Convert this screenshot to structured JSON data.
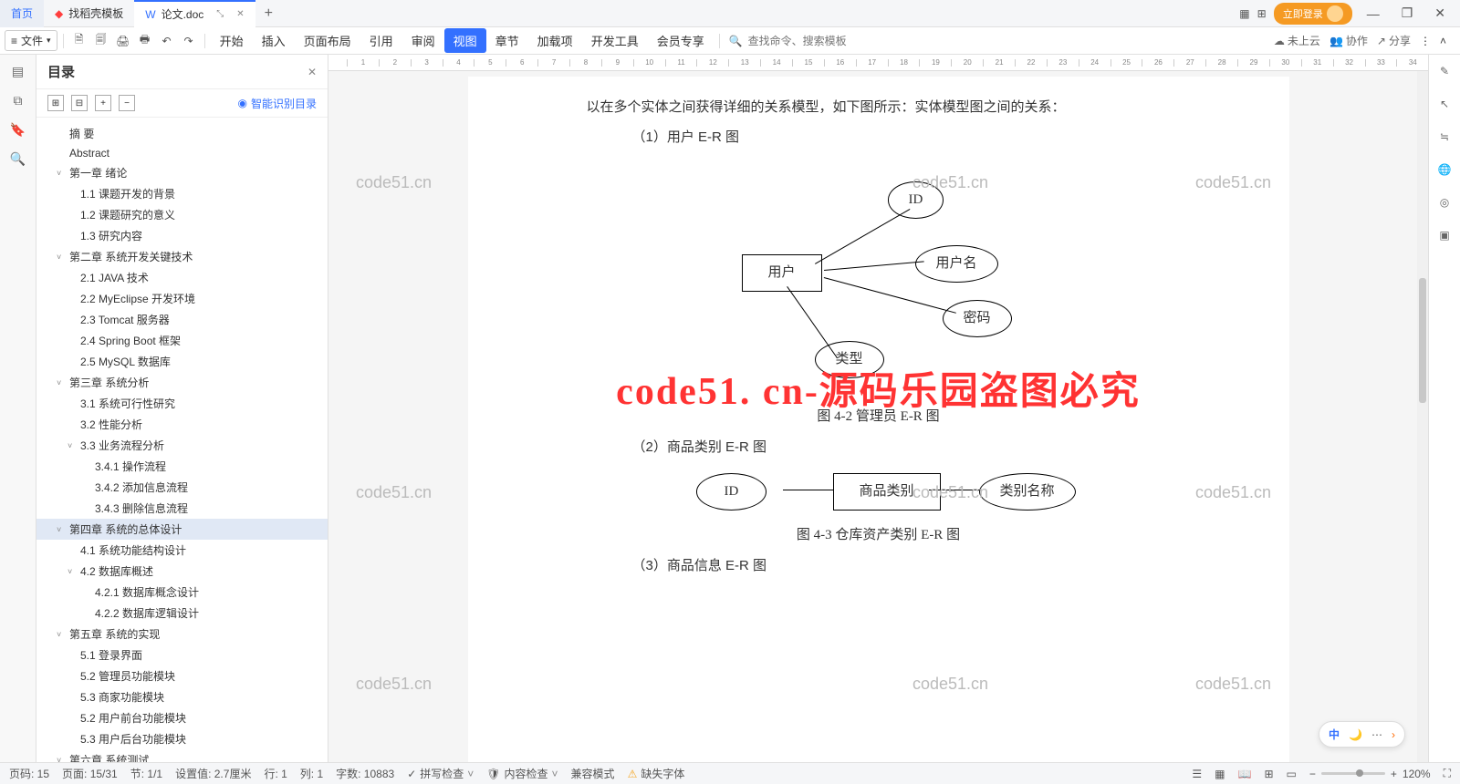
{
  "titlebar": {
    "home_tab": "首页",
    "template_tab": "找稻壳模板",
    "doc_tab": "论文.doc",
    "login": "立即登录"
  },
  "menubar": {
    "file": "文件",
    "items": [
      "开始",
      "插入",
      "页面布局",
      "引用",
      "审阅",
      "视图",
      "章节",
      "加载项",
      "开发工具",
      "会员专享"
    ],
    "active_index": 5,
    "search_placeholder": "查找命令、搜索模板",
    "right": {
      "cloud": "未上云",
      "collab": "协作",
      "share": "分享"
    }
  },
  "sidebar": {
    "title": "目录",
    "smart_toc": "智能识别目录",
    "items": [
      {
        "label": "摘 要",
        "lvl": 0
      },
      {
        "label": "Abstract",
        "lvl": 0
      },
      {
        "label": "第一章 绪论",
        "lvl": 0,
        "chev": true
      },
      {
        "label": "1.1 课题开发的背景",
        "lvl": 1
      },
      {
        "label": "1.2 课题研究的意义",
        "lvl": 1
      },
      {
        "label": "1.3 研究内容",
        "lvl": 1
      },
      {
        "label": "第二章 系统开发关键技术",
        "lvl": 0,
        "chev": true
      },
      {
        "label": "2.1 JAVA 技术",
        "lvl": 1
      },
      {
        "label": "2.2 MyEclipse 开发环境",
        "lvl": 1
      },
      {
        "label": "2.3 Tomcat 服务器",
        "lvl": 1
      },
      {
        "label": "2.4 Spring    Boot 框架",
        "lvl": 1
      },
      {
        "label": "2.5 MySQL 数据库",
        "lvl": 1
      },
      {
        "label": "第三章 系统分析",
        "lvl": 0,
        "chev": true
      },
      {
        "label": "3.1 系统可行性研究",
        "lvl": 1
      },
      {
        "label": "3.2 性能分析",
        "lvl": 1
      },
      {
        "label": "3.3 业务流程分析",
        "lvl": 1,
        "chev": true
      },
      {
        "label": "3.4.1 操作流程",
        "lvl": 2
      },
      {
        "label": "3.4.2 添加信息流程",
        "lvl": 2
      },
      {
        "label": "3.4.3 删除信息流程",
        "lvl": 2
      },
      {
        "label": "第四章  系统的总体设计",
        "lvl": 0,
        "chev": true,
        "selected": true
      },
      {
        "label": "4.1 系统功能结构设计",
        "lvl": 1
      },
      {
        "label": "4.2 数据库概述",
        "lvl": 1,
        "chev": true
      },
      {
        "label": "4.2.1 数据库概念设计",
        "lvl": 2
      },
      {
        "label": "4.2.2 数据库逻辑设计",
        "lvl": 2
      },
      {
        "label": "第五章 系统的实现",
        "lvl": 0,
        "chev": true
      },
      {
        "label": "5.1 登录界面",
        "lvl": 1
      },
      {
        "label": "5.2 管理员功能模块",
        "lvl": 1
      },
      {
        "label": "5.3 商家功能模块",
        "lvl": 1
      },
      {
        "label": "5.2 用户前台功能模块",
        "lvl": 1
      },
      {
        "label": "5.3 用户后台功能模块",
        "lvl": 1
      },
      {
        "label": "第六章 系统测试",
        "lvl": 0,
        "chev": true
      }
    ]
  },
  "doc": {
    "line1": "以在多个实体之间获得详细的关系模型，如下图所示：实体模型图之间的关系：",
    "heading1": "（1）用户 E-R 图",
    "er1": {
      "entity": "用户",
      "attrs": [
        "ID",
        "用户名",
        "密码",
        "类型"
      ]
    },
    "caption1": "图 4-2 管理员 E-R 图",
    "heading2": "（2）商品类别 E-R 图",
    "er2": {
      "entity": "商品类别",
      "attrs": [
        "ID",
        "类别名称"
      ]
    },
    "caption2": "图 4-3 仓库资产类别 E-R 图",
    "heading3": "（3）商品信息 E-R 图",
    "big_watermark": "code51. cn-源码乐园盗图必究",
    "small_watermark": "code51.cn"
  },
  "statusbar": {
    "page_code": "页码: 15",
    "page": "页面: 15/31",
    "section": "节: 1/1",
    "setting": "设置值: 2.7厘米",
    "line": "行: 1",
    "col": "列: 1",
    "words": "字数: 10883",
    "spellcheck": "拼写检查",
    "content_check": "内容检查",
    "compat": "兼容模式",
    "missing_font": "缺失字体",
    "zoom": "120%"
  },
  "float": {
    "lang": "中"
  },
  "ruler_max": 34
}
